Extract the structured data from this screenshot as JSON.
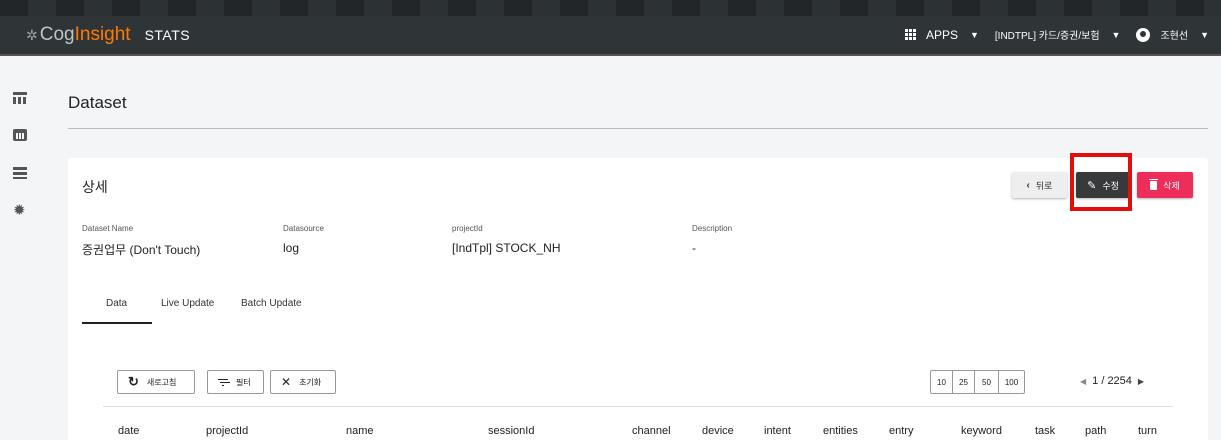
{
  "header": {
    "logo_cog": "Cog",
    "logo_insight": "Insight",
    "logo_stats": "STATS",
    "apps_label": "APPS",
    "project_select": "[INDTPL] 카드/증권/보험",
    "user_name": "조현선"
  },
  "sidebar": {
    "items": [
      {
        "icon": "table-icon"
      },
      {
        "icon": "chart-icon"
      },
      {
        "icon": "list-icon"
      },
      {
        "icon": "gear-icon"
      }
    ]
  },
  "page": {
    "title": "Dataset"
  },
  "detail": {
    "title": "상세",
    "back_label": "뒤로",
    "edit_label": "수정",
    "delete_label": "삭제",
    "fields": [
      {
        "label": "Dataset Name",
        "value": "증권업무 (Don't Touch)"
      },
      {
        "label": "Datasource",
        "value": "log"
      },
      {
        "label": "projectId",
        "value": "[IndTpl] STOCK_NH"
      },
      {
        "label": "Description",
        "value": "-"
      }
    ]
  },
  "tabs": [
    {
      "label": "Data",
      "active": true
    },
    {
      "label": "Live Update",
      "active": false
    },
    {
      "label": "Batch Update",
      "active": false
    }
  ],
  "toolbar": {
    "refresh_label": "새로고침",
    "filter_label": "필터",
    "reset_label": "초기화"
  },
  "pagination": {
    "sizes": [
      "10",
      "25",
      "50",
      "100"
    ],
    "page_info": "1 / 2254"
  },
  "table": {
    "columns": [
      "date",
      "projectId",
      "name",
      "sessionId",
      "channel",
      "device",
      "intent",
      "entities",
      "entry",
      "keyword",
      "task",
      "path",
      "turn"
    ]
  },
  "colors": {
    "accent_orange": "#ff7a00",
    "delete_red": "#ef2d5b",
    "highlight_red": "#e30d0d"
  }
}
